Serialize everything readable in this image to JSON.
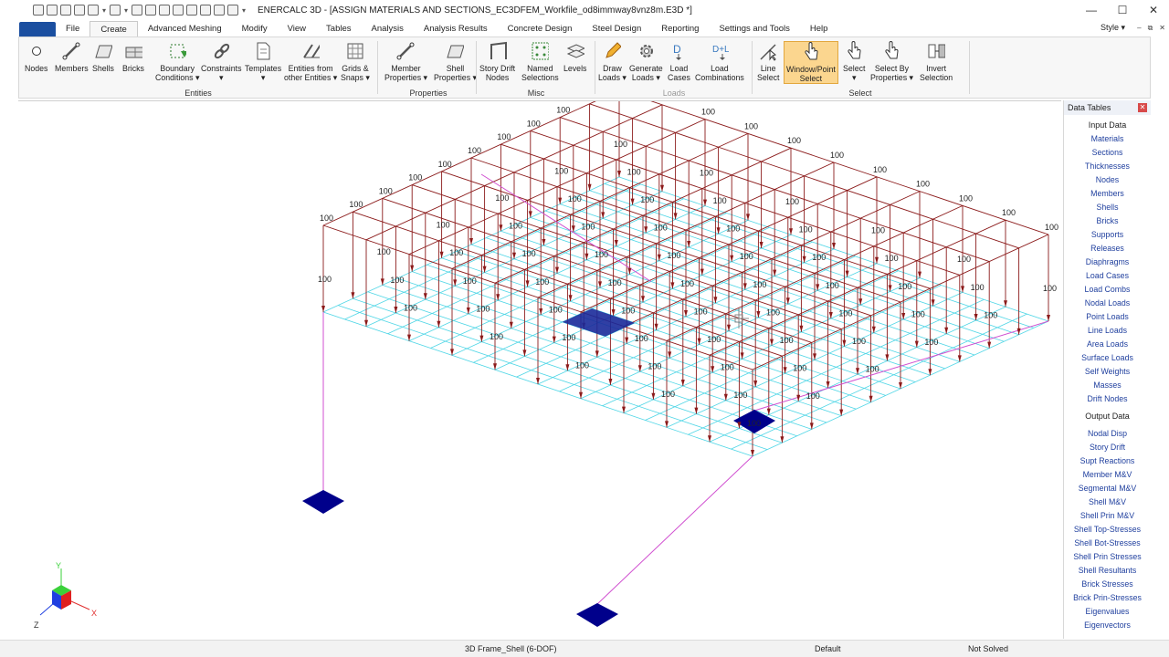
{
  "title_bar": {
    "title": "ENERCALC 3D - [ASSIGN MATERIALS AND SECTIONS_EC3DFEM_Workfile_od8immway8vnz8m.E3D *]",
    "quick_access_icons": [
      "hand-icon",
      "zoom-icon",
      "zoom-extents-icon",
      "rotate-icon",
      "view-icon",
      "window-icon",
      "render-icon",
      "grid-icon",
      "eye-icon",
      "eye-off-icon",
      "link-icon",
      "unlink-icon",
      "node-icon",
      "cursor-icon"
    ],
    "minimize": "—",
    "maximize": "☐",
    "close": "✕"
  },
  "tabs": [
    {
      "label": "File",
      "active": false
    },
    {
      "label": "Create",
      "active": true
    },
    {
      "label": "Advanced Meshing",
      "active": false
    },
    {
      "label": "Modify",
      "active": false
    },
    {
      "label": "View",
      "active": false
    },
    {
      "label": "Tables",
      "active": false
    },
    {
      "label": "Analysis",
      "active": false
    },
    {
      "label": "Analysis Results",
      "active": false
    },
    {
      "label": "Concrete Design",
      "active": false
    },
    {
      "label": "Steel Design",
      "active": false
    },
    {
      "label": "Reporting",
      "active": false
    },
    {
      "label": "Settings and Tools",
      "active": false
    },
    {
      "label": "Help",
      "active": false
    }
  ],
  "style_menu": "Style",
  "mdi_controls": [
    "–",
    "⧉",
    "✕"
  ],
  "ribbon": {
    "entities": {
      "label": "Entities",
      "buttons": [
        {
          "line1": "Nodes",
          "line2": ""
        },
        {
          "line1": "Members",
          "line2": ""
        },
        {
          "line1": "Shells",
          "line2": ""
        },
        {
          "line1": "Bricks",
          "line2": ""
        },
        {
          "line1": "Boundary",
          "line2": "Conditions ▾"
        },
        {
          "line1": "Constraints",
          "line2": "▾"
        },
        {
          "line1": "Templates",
          "line2": "▾"
        },
        {
          "line1": "Entities from",
          "line2": "other Entities ▾"
        },
        {
          "line1": "Grids &",
          "line2": "Snaps ▾"
        }
      ]
    },
    "properties": {
      "label": "Properties",
      "buttons": [
        {
          "line1": "Member",
          "line2": "Properties ▾"
        },
        {
          "line1": "Shell",
          "line2": "Properties ▾"
        }
      ]
    },
    "misc": {
      "label": "Misc",
      "buttons": [
        {
          "line1": "Story Drift",
          "line2": "Nodes"
        },
        {
          "line1": "Named",
          "line2": "Selections"
        },
        {
          "line1": "Levels",
          "line2": ""
        }
      ]
    },
    "loads": {
      "label": "Loads",
      "buttons": [
        {
          "line1": "Draw",
          "line2": "Loads ▾"
        },
        {
          "line1": "Generate",
          "line2": "Loads ▾"
        },
        {
          "line1": "Load",
          "line2": "Cases"
        },
        {
          "line1": "Load",
          "line2": "Combinations"
        }
      ]
    },
    "select": {
      "label": "Select",
      "buttons": [
        {
          "line1": "Line",
          "line2": "Select"
        },
        {
          "line1": "Window/Point",
          "line2": "Select"
        },
        {
          "line1": "Select",
          "line2": "▾"
        },
        {
          "line1": "Select By",
          "line2": "Properties ▾"
        },
        {
          "line1": "Invert",
          "line2": "Selection"
        }
      ]
    }
  },
  "viewport": {
    "load_label": "100",
    "axis_x": "X",
    "axis_y": "Y",
    "axis_z": "Z",
    "colors": {
      "frame": "#8b1a1a",
      "grid": "#4fd6e6",
      "columns": "#d04fd0",
      "supports": "#00008b",
      "load_arrows": "#8b1a1a"
    }
  },
  "data_tables": {
    "title": "Data Tables",
    "close": "✕",
    "input_header": "Input Data",
    "input_items": [
      "Materials",
      "Sections",
      "Thicknesses",
      "Nodes",
      "Members",
      "Shells",
      "Bricks",
      "Supports",
      "Releases",
      "Diaphragms",
      "Load Cases",
      "Load Combs",
      "Nodal Loads",
      "Point Loads",
      "Line Loads",
      "Area Loads",
      "Surface Loads",
      "Self Weights",
      "Masses",
      "Drift Nodes"
    ],
    "output_header": "Output Data",
    "output_items": [
      "Nodal Disp",
      "Story Drift",
      "Supt Reactions",
      "Member M&V",
      "Segmental M&V",
      "Shell M&V",
      "Shell Prin M&V",
      "Shell Top-Stresses",
      "Shell Bot-Stresses",
      "Shell Prin Stresses",
      "Shell Resultants",
      "Brick Stresses",
      "Brick Prin-Stresses",
      "Eigenvalues",
      "Eigenvectors"
    ]
  },
  "status_bar": {
    "mode": "3D Frame_Shell (6-DOF)",
    "combo": "Default",
    "solve_state": "Not Solved"
  }
}
